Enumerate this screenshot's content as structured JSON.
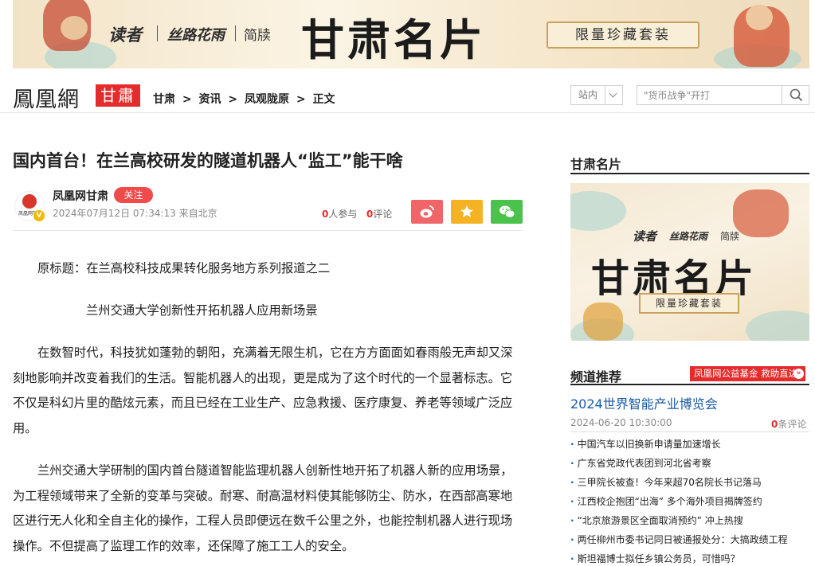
{
  "banner": {
    "brand_duzhe": "读者",
    "brand_sichou": "丝路花雨",
    "brand_jiandu": "简牍",
    "title": "甘肃名片",
    "badge": "限量珍藏套装"
  },
  "nav": {
    "logo_text": "鳳凰網",
    "logo_region": "甘肅",
    "breadcrumbs": [
      "甘肃",
      "资讯",
      "凤观陇原",
      "正文"
    ],
    "breadcrumb_sep": ">",
    "site_select": "站内",
    "search_placeholder": "\"货币战争\"开打"
  },
  "article": {
    "title": "国内首台！在兰高校研发的隧道机器人“监工”能干啥",
    "author": "凤凰网甘肃",
    "follow_label": "关注",
    "avatar_text": "凤凰网甘肃",
    "avatar_badge": "V",
    "datetime": "2024年07月12日 07:34:13 来自北京",
    "participants_num": "0",
    "participants_label": "人参与",
    "comments_num": "0",
    "comments_label": "评论",
    "paragraphs": [
      "原标题：在兰高校科技成果转化服务地方系列报道之二",
      "兰州交通大学创新性开拓机器人应用新场景",
      "在数智时代，科技犹如蓬勃的朝阳，充满着无限生机，它在方方面面如春雨般无声却又深刻地影响并改变着我们的生活。智能机器人的出现，更是成为了这个时代的一个显著标志。它不仅是科幻片里的酷炫元素，而且已经在工业生产、应急救援、医疗康复、养老等领域广泛应用。",
      "兰州交通大学研制的国内首台隧道智能监理机器人创新性地开拓了机器人新的应用场景，为工程领域带来了全新的变革与突破。耐寒、耐高温材料使其能够防尘、防水，在西部高寒地区进行无人化和全自主化的操作，工程人员即便远在数千公里之外，也能控制机器人进行现场操作。不但提高了监理工作的效率，还保障了施工工人的安全。"
    ]
  },
  "sidebar": {
    "card_heading": "甘肃名片",
    "card_image": {
      "brand_duzhe": "读者",
      "brand_sichou": "丝路花雨",
      "brand_jiandu": "简牍",
      "title": "甘肃名片",
      "badge": "限量珍藏套装"
    },
    "channel_heading": "频道推荐",
    "promo_label": "凤凰网公益基金  救助直达",
    "promo_chevron": "»",
    "feature": {
      "title": "2024世界智能产业博览会",
      "date": "2024-06-20 10:30:00",
      "comments_num": "0",
      "comments_label": "条评论"
    },
    "news": [
      "中国汽车以旧换新申请量加速增长",
      "广东省党政代表团到河北省考察",
      "三甲院长被查！今年来超70名院长书记落马",
      "江西校企抱团“出海” 多个海外项目揭牌签约",
      "“北京旅游景区全面取消预约” 冲上热搜",
      "两任柳州市委书记同日被通报处分：大搞政绩工程",
      "斯坦福博士拟任乡镇公务员，可惜吗？"
    ]
  },
  "colors": {
    "brand_red": "#e52c2c",
    "link_blue": "#1a5aa6",
    "weibo": "#f06568",
    "favorite": "#f5b323",
    "wechat": "#4bc34b"
  },
  "icons": [
    "search-icon",
    "chevron-down-icon",
    "weibo-icon",
    "star-icon",
    "wechat-icon",
    "phoenix-logo-icon",
    "verified-icon"
  ]
}
